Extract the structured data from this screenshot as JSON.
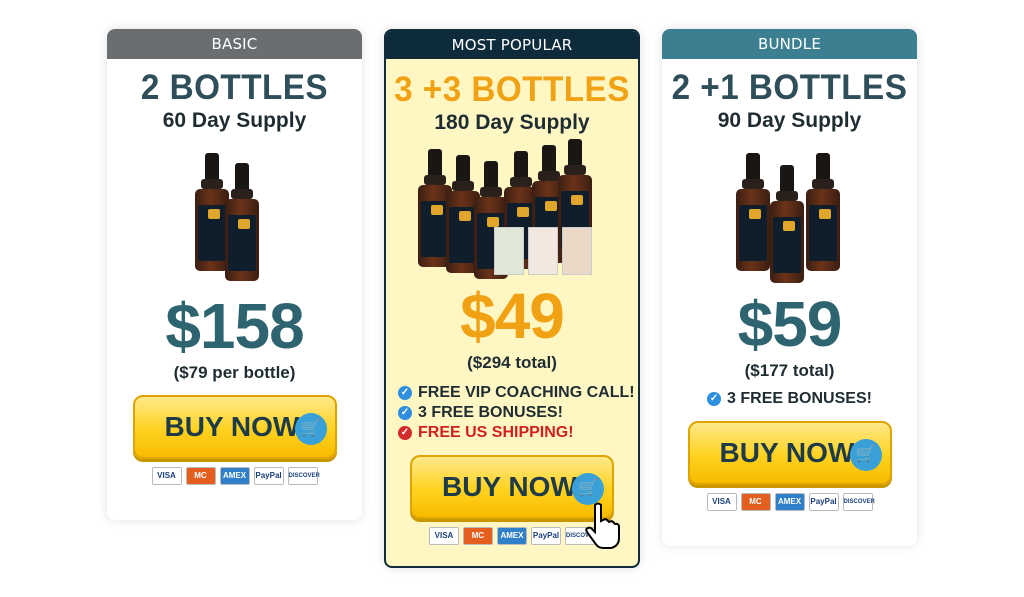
{
  "plans": [
    {
      "header": "BASIC",
      "quantity": "2 BOTTLES",
      "supply": "60 Day Supply",
      "price": "$158",
      "price_note": "($79 per bottle)",
      "benefits": [],
      "buy_label": "BUY NOW"
    },
    {
      "header": "MOST POPULAR",
      "quantity": "3 +3 BOTTLES",
      "supply": "180 Day Supply",
      "price": "$49",
      "price_note": "($294 total)",
      "benefits": [
        {
          "text": "FREE VIP COACHING CALL!",
          "icon": "check-icon"
        },
        {
          "text": "3 FREE BONUSES!",
          "icon": "check-icon"
        },
        {
          "text": "FREE US SHIPPING!",
          "icon": "check-icon"
        }
      ],
      "buy_label": "BUY NOW"
    },
    {
      "header": "BUNDLE",
      "quantity": "2 +1 BOTTLES",
      "supply": "90 Day Supply",
      "price": "$59",
      "price_note": "($177 total)",
      "benefits": [
        {
          "text": "3 FREE BONUSES!",
          "icon": "check-icon"
        }
      ],
      "buy_label": "BUY NOW"
    }
  ],
  "payment_methods": [
    "VISA",
    "MC",
    "AMEX",
    "PayPal",
    "DISCOVER"
  ],
  "colors": {
    "basic_header": "#6a6e71",
    "popular_header": "#0e2b3c",
    "bundle_header": "#3b7f90",
    "accent_orange": "#f0a214",
    "price_teal": "#2e6470",
    "buy_yellow": "#ffd21f"
  }
}
